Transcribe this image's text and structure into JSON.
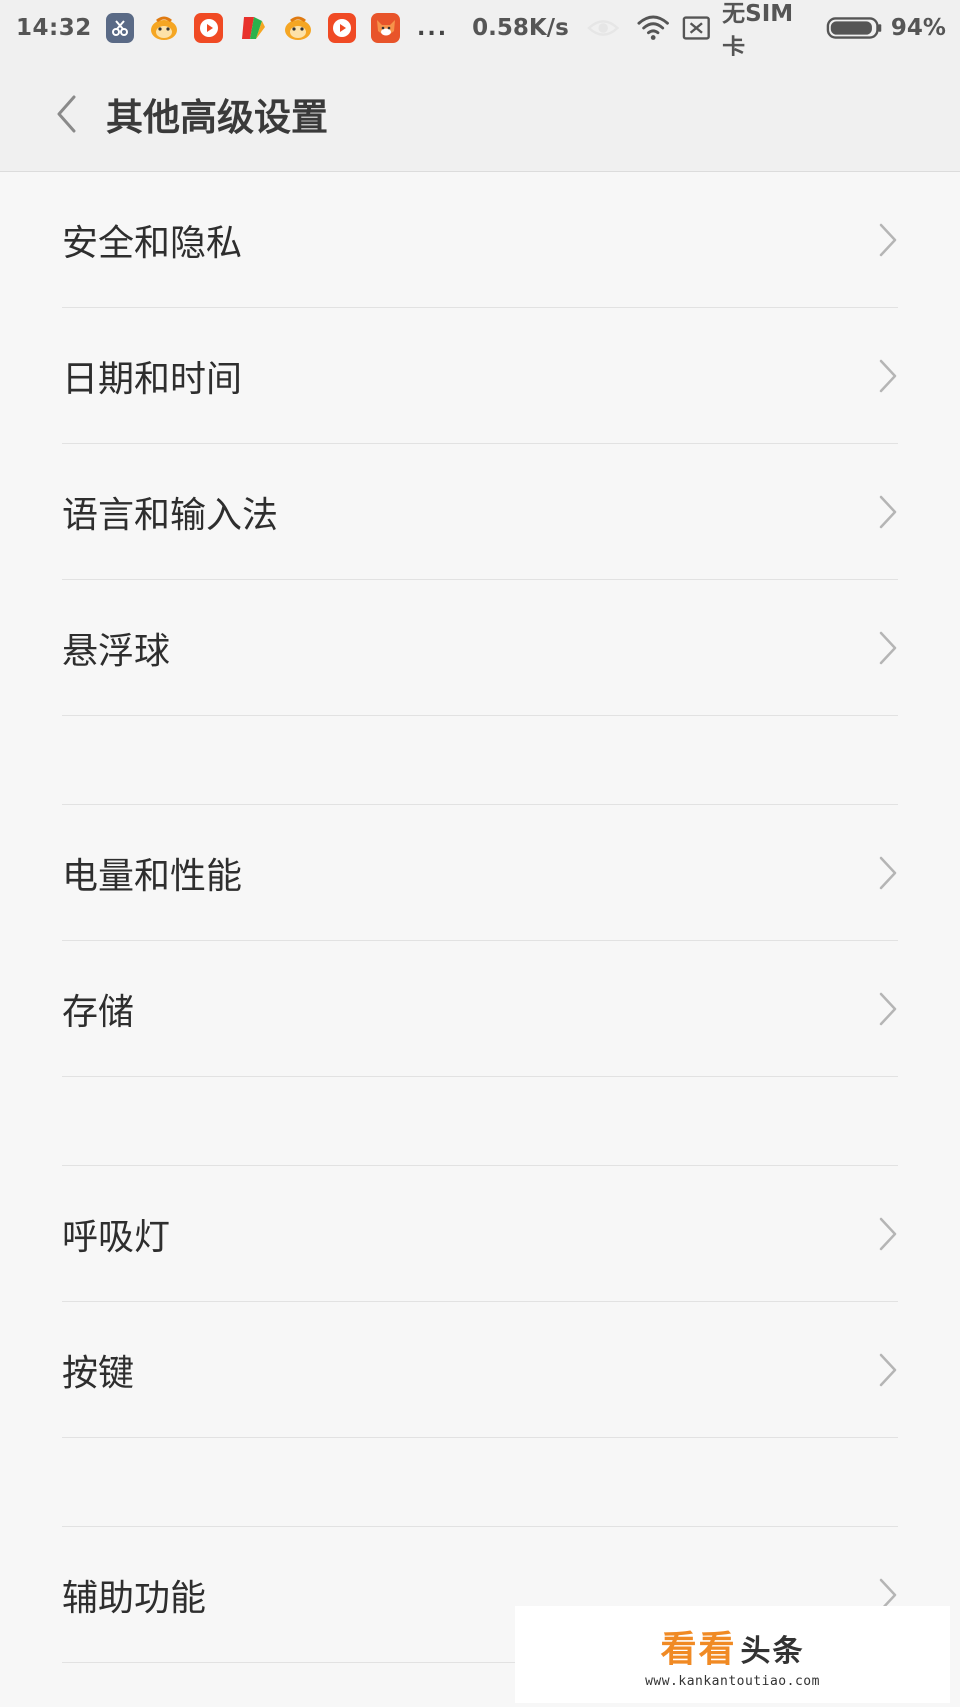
{
  "status_bar": {
    "time": "14:32",
    "notification_icons": [
      {
        "name": "screenshot-app-icon",
        "color": "#5a6a86"
      },
      {
        "name": "monkey-app-icon",
        "color": "#f5a623"
      },
      {
        "name": "video-app-icon",
        "color": "#f04a24"
      },
      {
        "name": "colorful-app-icon",
        "color": "#2bb24c"
      },
      {
        "name": "monkey-app-icon",
        "color": "#f5a623"
      },
      {
        "name": "video-app-icon",
        "color": "#f04a24"
      },
      {
        "name": "fox-app-icon",
        "color": "#e8542a"
      }
    ],
    "more": "...",
    "speed": "0.58K/s",
    "sim": "无SIM卡",
    "battery": "94%",
    "battery_level": 0.94
  },
  "header": {
    "title": "其他高级设置"
  },
  "settings": {
    "group1": [
      {
        "label": "安全和隐私"
      },
      {
        "label": "日期和时间"
      },
      {
        "label": "语言和输入法"
      },
      {
        "label": "悬浮球"
      }
    ],
    "group2": [
      {
        "label": "电量和性能"
      },
      {
        "label": "存储"
      }
    ],
    "group3": [
      {
        "label": "呼吸灯"
      },
      {
        "label": "按键"
      }
    ],
    "group4": [
      {
        "label": "辅助功能"
      }
    ]
  },
  "watermark": {
    "brand": "看看",
    "suffix": "头条",
    "url": "www.kankantoutiao.com"
  },
  "colors": {
    "background": "#f7f7f7",
    "header_background": "#f0f0f0",
    "divider": "#e2e2e2",
    "chevron": "#b5b5b5",
    "watermark_brand": "#f08a24"
  }
}
